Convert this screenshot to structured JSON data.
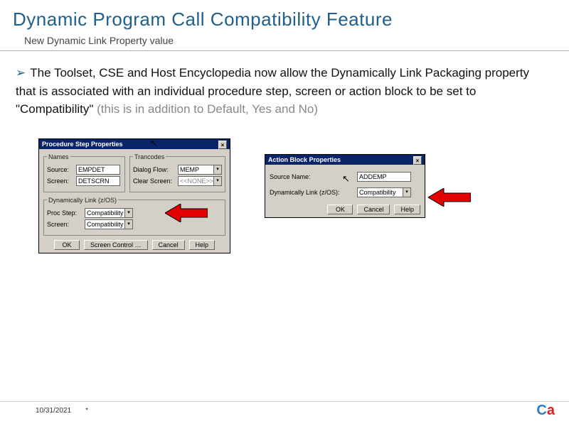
{
  "title": "Dynamic Program Call Compatibility Feature",
  "subtitle": "New Dynamic Link Property value",
  "body": {
    "bullet": "➢",
    "main": "The Toolset, CSE and Host Encyclopedia now allow the Dynamically Link Packaging property that is associated with an individual procedure step, screen or action block to be set to \"Compatibility\"",
    "gray": " (this is in addition to Default, Yes and No)"
  },
  "dlg1": {
    "title": "Procedure Step Properties",
    "names_legend": "Names",
    "source_lbl": "Source:",
    "source_val": "EMPDET",
    "screen_lbl": "Screen:",
    "screen_val": "DETSCRN",
    "tran_legend": "Trancodes",
    "dialog_lbl": "Dialog Flow:",
    "dialog_val": "MEMP",
    "clear_lbl": "Clear Screen:",
    "clear_val": "<<NONE>>",
    "dyn_legend": "Dynamically Link (z/OS)",
    "proc_lbl": "Proc Step:",
    "proc_val": "Compatibility",
    "scr2_lbl": "Screen:",
    "scr2_val": "Compatibility",
    "btn_ok": "OK",
    "btn_screen": "Screen Control …",
    "btn_cancel": "Cancel",
    "btn_help": "Help"
  },
  "dlg2": {
    "title": "Action Block Properties",
    "source_lbl": "Source Name:",
    "source_val": "ADDEMP",
    "dyn_lbl": "Dynamically Link (z/OS):",
    "dyn_val": "Compatibility",
    "btn_ok": "OK",
    "btn_cancel": "Cancel",
    "btn_help": "Help"
  },
  "footer": {
    "date": "10/31/2021",
    "mark": "*"
  },
  "logo": {
    "c": "C",
    "a": "a"
  }
}
